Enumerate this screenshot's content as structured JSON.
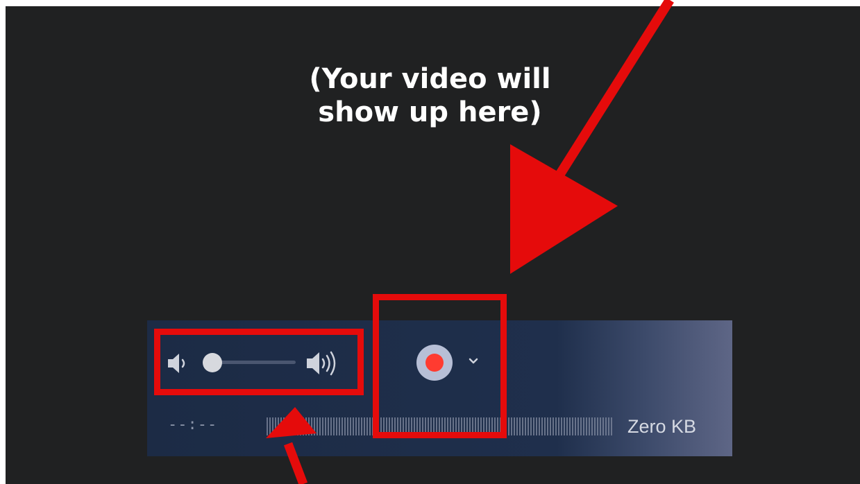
{
  "video_area": {
    "placeholder_line1": "(Your video will",
    "placeholder_line2": "show up here)"
  },
  "controls": {
    "volume": {
      "min_icon": "speaker-low-icon",
      "max_icon": "speaker-high-icon",
      "level": 0.0
    },
    "record": {
      "icon": "record-icon",
      "options_icon": "chevron-down-icon"
    },
    "elapsed_time": "--:--",
    "file_size": "Zero KB"
  },
  "colors": {
    "annotation_red": "#e50b0b",
    "record_red": "#ff3b30",
    "background": "#202122",
    "controls_bg": "#1c2b45"
  }
}
